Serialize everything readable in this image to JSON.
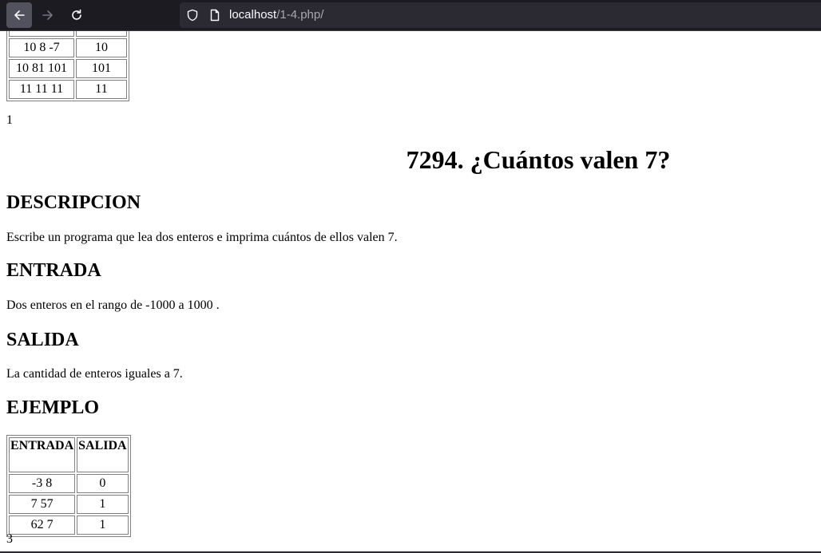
{
  "browser": {
    "url_host": "localhost",
    "url_path": "/1-4.php/"
  },
  "prev_table": {
    "rows": [
      {
        "entrada": "",
        "salida": ""
      },
      {
        "entrada": "10 8 -7",
        "salida": "10"
      },
      {
        "entrada": "10 81 101",
        "salida": "101"
      },
      {
        "entrada": "11 11 11",
        "salida": "11"
      }
    ]
  },
  "prev_count": "1",
  "problem": {
    "title": "7294. ¿Cuántos valen 7?",
    "descripcion_heading": "DESCRIPCION",
    "descripcion_text": "Escribe un programa que lea dos enteros e imprima cuántos de ellos valen 7.",
    "entrada_heading": "ENTRADA",
    "entrada_text": "Dos enteros en el rango de -1000 a 1000 .",
    "salida_heading": "SALIDA",
    "salida_text": "La cantidad de enteros iguales a 7.",
    "ejemplo_heading": "EJEMPLO"
  },
  "example_table": {
    "headers": [
      "ENTRADA",
      "SALIDA"
    ],
    "rows": [
      {
        "entrada": "-3 8",
        "salida": "0"
      },
      {
        "entrada": "7 57",
        "salida": "1"
      },
      {
        "entrada": "62 7",
        "salida": "1"
      }
    ]
  },
  "example_count": "3"
}
